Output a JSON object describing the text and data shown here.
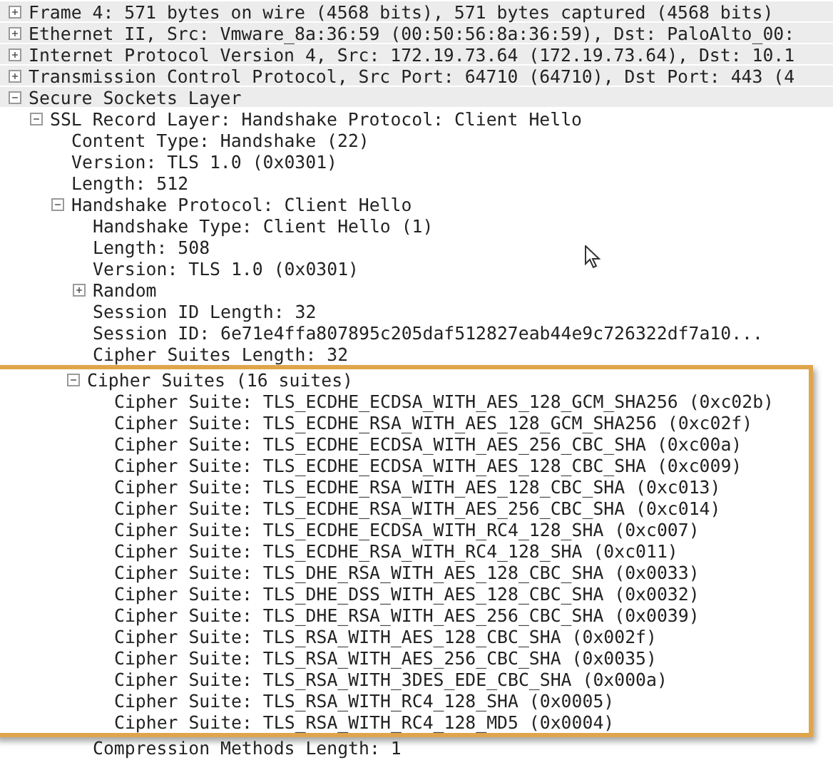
{
  "tree": [
    {
      "label": "Frame 4: 571 bytes on wire (4568 bits), 571 bytes captured (4568 bits)",
      "expanded": false
    },
    {
      "label": "Ethernet II, Src: Vmware_8a:36:59 (00:50:56:8a:36:59), Dst: PaloAlto_00:",
      "expanded": false
    },
    {
      "label": "Internet Protocol Version 4, Src: 172.19.73.64 (172.19.73.64), Dst: 10.1",
      "expanded": false
    },
    {
      "label": "Transmission Control Protocol, Src Port: 64710 (64710), Dst Port: 443 (4",
      "expanded": false
    },
    {
      "label": "Secure Sockets Layer",
      "expanded": true,
      "children": [
        {
          "label": "SSL Record Layer: Handshake Protocol: Client Hello",
          "expanded": true,
          "children": [
            {
              "label": "Content Type: Handshake (22)"
            },
            {
              "label": "Version: TLS 1.0 (0x0301)"
            },
            {
              "label": "Length: 512"
            },
            {
              "label": "Handshake Protocol: Client Hello",
              "expanded": true,
              "children": [
                {
                  "label": "Handshake Type: Client Hello (1)"
                },
                {
                  "label": "Length: 508"
                },
                {
                  "label": "Version: TLS 1.0 (0x0301)"
                },
                {
                  "label": "Random",
                  "expanded": false
                },
                {
                  "label": "Session ID Length: 32"
                },
                {
                  "label": "Session ID: 6e71e4ffa807895c205daf512827eab44e9c726322df7a10..."
                },
                {
                  "label": "Cipher Suites Length: 32"
                },
                {
                  "label": "Cipher Suites (16 suites)",
                  "expanded": true,
                  "highlighted": true,
                  "children": [
                    {
                      "label": "Cipher Suite: TLS_ECDHE_ECDSA_WITH_AES_128_GCM_SHA256 (0xc02b)"
                    },
                    {
                      "label": "Cipher Suite: TLS_ECDHE_RSA_WITH_AES_128_GCM_SHA256 (0xc02f)"
                    },
                    {
                      "label": "Cipher Suite: TLS_ECDHE_ECDSA_WITH_AES_256_CBC_SHA (0xc00a)"
                    },
                    {
                      "label": "Cipher Suite: TLS_ECDHE_ECDSA_WITH_AES_128_CBC_SHA (0xc009)"
                    },
                    {
                      "label": "Cipher Suite: TLS_ECDHE_RSA_WITH_AES_128_CBC_SHA (0xc013)"
                    },
                    {
                      "label": "Cipher Suite: TLS_ECDHE_RSA_WITH_AES_256_CBC_SHA (0xc014)"
                    },
                    {
                      "label": "Cipher Suite: TLS_ECDHE_ECDSA_WITH_RC4_128_SHA (0xc007)"
                    },
                    {
                      "label": "Cipher Suite: TLS_ECDHE_RSA_WITH_RC4_128_SHA (0xc011)"
                    },
                    {
                      "label": "Cipher Suite: TLS_DHE_RSA_WITH_AES_128_CBC_SHA (0x0033)"
                    },
                    {
                      "label": "Cipher Suite: TLS_DHE_DSS_WITH_AES_128_CBC_SHA (0x0032)"
                    },
                    {
                      "label": "Cipher Suite: TLS_DHE_RSA_WITH_AES_256_CBC_SHA (0x0039)"
                    },
                    {
                      "label": "Cipher Suite: TLS_RSA_WITH_AES_128_CBC_SHA (0x002f)"
                    },
                    {
                      "label": "Cipher Suite: TLS_RSA_WITH_AES_256_CBC_SHA (0x0035)"
                    },
                    {
                      "label": "Cipher Suite: TLS_RSA_WITH_3DES_EDE_CBC_SHA (0x000a)"
                    },
                    {
                      "label": "Cipher Suite: TLS_RSA_WITH_RC4_128_SHA (0x0005)"
                    },
                    {
                      "label": "Cipher Suite: TLS_RSA_WITH_RC4_128_MD5 (0x0004)"
                    }
                  ]
                },
                {
                  "label": "Compression Methods Length: 1"
                }
              ]
            }
          ]
        }
      ]
    }
  ]
}
